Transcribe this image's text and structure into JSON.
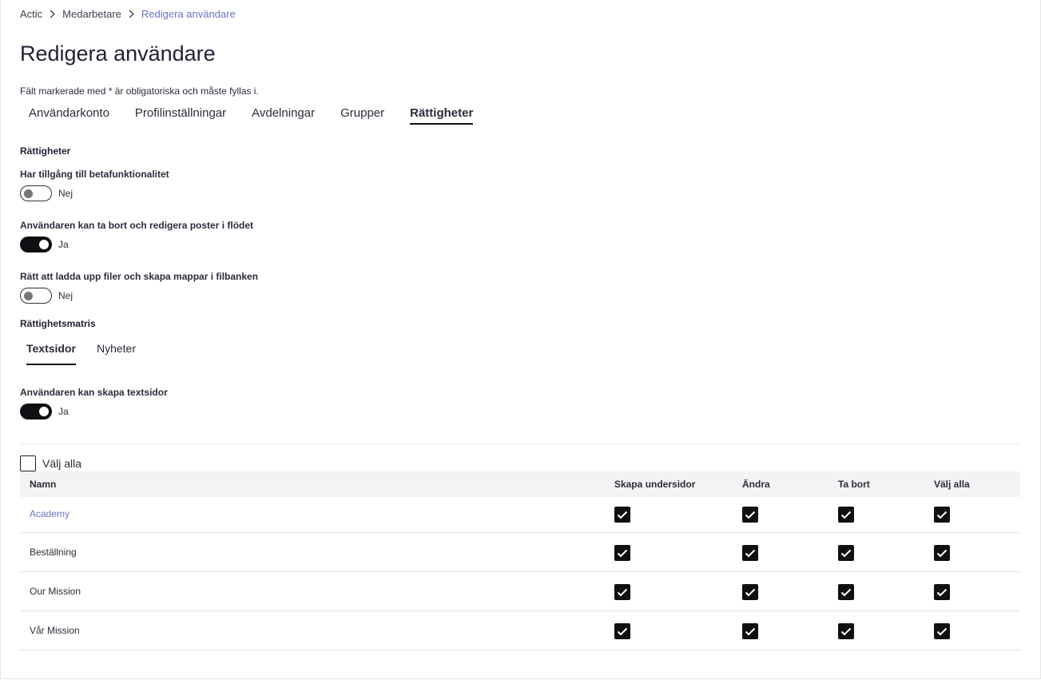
{
  "breadcrumb": [
    {
      "label": "Actic"
    },
    {
      "label": "Medarbetare"
    },
    {
      "label": "Redigera användare"
    }
  ],
  "page": {
    "title": "Redigera användare",
    "required_note": "Fält markerade med * är obligatoriska och måste fyllas i."
  },
  "tabs": [
    {
      "label": "Användarkonto",
      "active": false
    },
    {
      "label": "Profilinställningar",
      "active": false
    },
    {
      "label": "Avdelningar",
      "active": false
    },
    {
      "label": "Grupper",
      "active": false
    },
    {
      "label": "Rättigheter",
      "active": true
    }
  ],
  "permissions": {
    "heading": "Rättigheter",
    "items": [
      {
        "label": "Har tillgång till betafunktionalitet",
        "enabled": false,
        "state_text": "Nej"
      },
      {
        "label": "Användaren kan ta bort och redigera poster i flödet",
        "enabled": true,
        "state_text": "Ja"
      },
      {
        "label": "Rätt att ladda upp filer och skapa mappar i filbanken",
        "enabled": false,
        "state_text": "Nej"
      }
    ]
  },
  "matrix": {
    "heading": "Rättighetsmatris",
    "subtabs": [
      {
        "label": "Textsidor",
        "active": true
      },
      {
        "label": "Nyheter",
        "active": false
      }
    ],
    "create_pages": {
      "label": "Användaren kan skapa textsidor",
      "enabled": true,
      "state_text": "Ja"
    },
    "select_all_label": "Välj alla",
    "columns": [
      "Namn",
      "Skapa undersidor",
      "Ändra",
      "Ta bort",
      "Välj alla"
    ],
    "rows": [
      {
        "name": "Academy",
        "link": true,
        "checks": [
          true,
          true,
          true,
          true
        ]
      },
      {
        "name": "Beställning",
        "link": false,
        "checks": [
          true,
          true,
          true,
          true
        ]
      },
      {
        "name": "Our Mission",
        "link": false,
        "checks": [
          true,
          true,
          true,
          true
        ]
      },
      {
        "name": "Vår Mission",
        "link": false,
        "checks": [
          true,
          true,
          true,
          true
        ]
      }
    ]
  },
  "icons": {
    "breadcrumb_separator": "chevron-right-icon",
    "checkbox_checked": "checkmark-icon"
  },
  "colors": {
    "link": "#6d73c9",
    "toggle_on": "#0f0f14",
    "header_bg": "#f3f3f3"
  }
}
